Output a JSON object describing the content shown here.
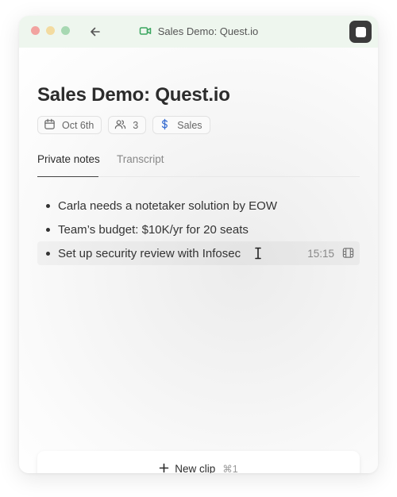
{
  "window": {
    "title": "Sales Demo: Quest.io",
    "title_icon": "video-camera-icon",
    "accent_color": "#3aa55f"
  },
  "meeting": {
    "title": "Sales Demo: Quest.io",
    "date": "Oct 6th",
    "attendees": "3",
    "category": "Sales"
  },
  "tabs": [
    {
      "label": "Private notes",
      "active": true
    },
    {
      "label": "Transcript",
      "active": false
    }
  ],
  "notes": [
    {
      "text": "Carla needs a notetaker solution by EOW"
    },
    {
      "text": "Team’s budget: $10K/yr for 20 seats"
    },
    {
      "text": "Set up security review with Infosec",
      "time": "15:15",
      "icon": "film-clip-icon"
    }
  ],
  "new_clip": {
    "label": "New clip",
    "shortcut": "⌘1"
  }
}
